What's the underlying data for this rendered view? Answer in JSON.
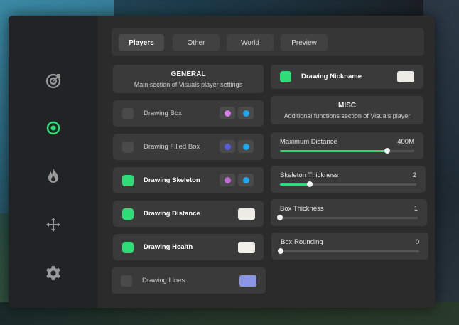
{
  "colors": {
    "accent": "#2edd77",
    "window": "#2a2a2a",
    "card": "#3a3a3a",
    "sidebar": "#222325"
  },
  "sidebar": {
    "items": [
      {
        "icon": "target-icon",
        "active": false
      },
      {
        "icon": "eye-icon",
        "active": true
      },
      {
        "icon": "flame-icon",
        "active": false
      },
      {
        "icon": "move-icon",
        "active": false
      },
      {
        "icon": "gear-icon",
        "active": false
      }
    ]
  },
  "tabs": [
    {
      "label": "Players",
      "active": true
    },
    {
      "label": "Other",
      "active": false
    },
    {
      "label": "World",
      "active": false
    },
    {
      "label": "Preview",
      "active": false
    }
  ],
  "general": {
    "title": "GENERAL",
    "subtitle": "Main section of Visuals player settings"
  },
  "misc": {
    "title": "MISC",
    "subtitle": "Additional functions section of Visuals player"
  },
  "options": [
    {
      "label": "Drawing Box",
      "checked": false,
      "colors": [
        "#d47fe6",
        "#1fa6ee"
      ]
    },
    {
      "label": "Drawing Filled Box",
      "checked": false,
      "colors": [
        "#5b5bdc",
        "#1fa6ee"
      ]
    },
    {
      "label": "Drawing Skeleton",
      "checked": true,
      "colors": [
        "#c06ad6",
        "#1fa6ee"
      ]
    },
    {
      "label": "Drawing Distance",
      "checked": true,
      "swatch": "#ecebe6"
    },
    {
      "label": "Drawing Health",
      "checked": true,
      "swatch": "#f0efea"
    },
    {
      "label": "Drawing Lines",
      "checked": false,
      "swatch": "#8b95e6"
    }
  ],
  "nickname": {
    "label": "Drawing Nickname",
    "checked": true,
    "swatch": "#ecebe6"
  },
  "sliders": [
    {
      "label": "Maximum Distance",
      "value": "400M",
      "fraction": 0.8
    },
    {
      "label": "Skeleton Thickness",
      "value": "2",
      "fraction": 0.22
    },
    {
      "label": "Box Thickness",
      "value": "1",
      "fraction": 0.0
    },
    {
      "label": "Box Rounding",
      "value": "0",
      "fraction": 0.0
    }
  ]
}
